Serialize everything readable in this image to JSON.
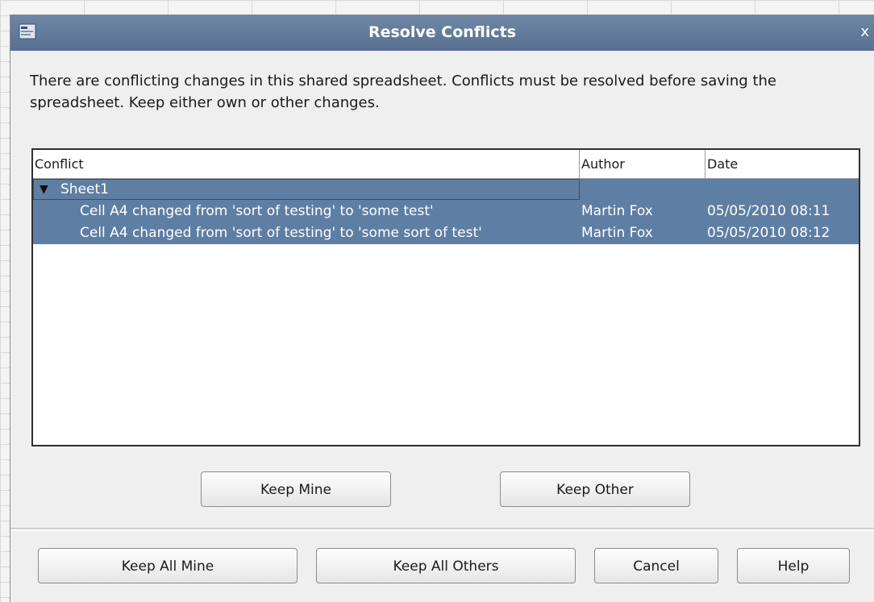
{
  "window": {
    "title": "Resolve Conflicts",
    "close_glyph": "x",
    "icon": "app-icon"
  },
  "message": "There are conflicting changes in this shared spreadsheet. Conflicts must be resolved before saving the spreadsheet. Keep either own or other changes.",
  "list": {
    "columns": {
      "conflict": "Conflict",
      "author": "Author",
      "date": "Date"
    },
    "group": {
      "expander": "▼",
      "label": "Sheet1"
    },
    "rows": [
      {
        "conflict": "Cell A4 changed from 'sort of testing' to 'some test'",
        "author": "Martin Fox",
        "date": "05/05/2010 08:11"
      },
      {
        "conflict": "Cell A4 changed from 'sort of testing' to 'some sort of test'",
        "author": "Martin Fox",
        "date": "05/05/2010 08:12"
      }
    ]
  },
  "buttons": {
    "keep_mine": "Keep Mine",
    "keep_other": "Keep Other",
    "keep_all_mine": "Keep All Mine",
    "keep_all_others": "Keep All Others",
    "cancel": "Cancel",
    "help": "Help"
  },
  "colors": {
    "titlebar": "#6a82a1",
    "selection": "#5f7ea3",
    "text": "#1a1a1a"
  }
}
